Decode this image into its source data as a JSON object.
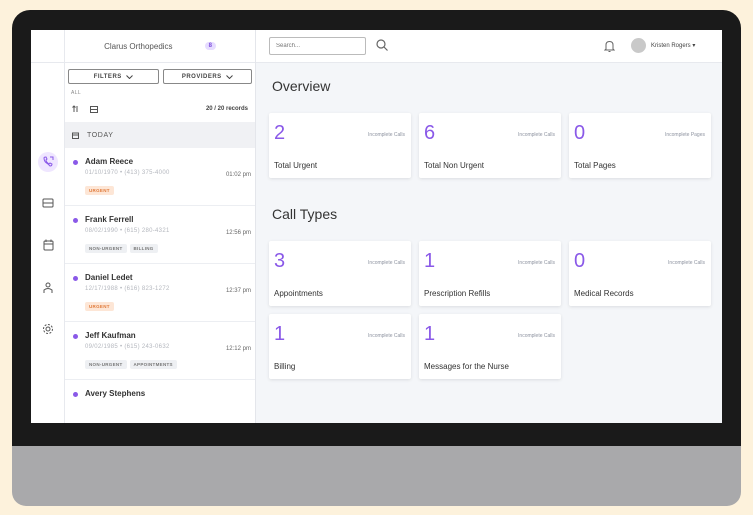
{
  "colors": {
    "accent": "#8a59e8",
    "urgent_tag": "#e07a3a",
    "background": "#fdf2dc"
  },
  "sidebar": {
    "clinic_name": "Clarus Orthopedics",
    "clinic_badge": "8"
  },
  "filters": {
    "filters_label": "FILTERS",
    "providers_label": "PROVIDERS",
    "all_label": "ALL",
    "records": "20 / 20 records"
  },
  "list": {
    "group_label": "TODAY",
    "entries": [
      {
        "name": "Adam Reece",
        "info": "01/10/1970  •  (413) 375-4000",
        "time": "01:02 pm",
        "tags": [
          "URGENT"
        ]
      },
      {
        "name": "Frank Ferrell",
        "info": "08/02/1990  •  (615) 280-4321",
        "time": "12:56 pm",
        "tags": [
          "NON-URGENT",
          "BILLING"
        ]
      },
      {
        "name": "Daniel Ledet",
        "info": "12/17/1988  •  (616) 823-1272",
        "time": "12:37 pm",
        "tags": [
          "URGENT"
        ]
      },
      {
        "name": "Jeff Kaufman",
        "info": "09/02/1985  •  (615) 243-0632",
        "time": "12:12 pm",
        "tags": [
          "NON-URGENT",
          "APPOINTMENTS"
        ]
      },
      {
        "name": "Avery Stephens",
        "info": "",
        "time": "",
        "tags": []
      }
    ]
  },
  "topbar": {
    "search_placeholder": "Search...",
    "user_name": "Kristen Rogers"
  },
  "overview": {
    "title": "Overview",
    "cards": [
      {
        "value": "2",
        "sub": "Incomplete Calls",
        "label": "Total Urgent"
      },
      {
        "value": "6",
        "sub": "Incomplete Calls",
        "label": "Total Non Urgent"
      },
      {
        "value": "0",
        "sub": "Incomplete Pages",
        "label": "Total Pages"
      }
    ]
  },
  "call_types": {
    "title": "Call Types",
    "cards": [
      {
        "value": "3",
        "sub": "Incomplete Calls",
        "label": "Appointments"
      },
      {
        "value": "1",
        "sub": "Incomplete Calls",
        "label": "Prescription Refills"
      },
      {
        "value": "0",
        "sub": "Incomplete Calls",
        "label": "Medical Records"
      },
      {
        "value": "1",
        "sub": "Incomplete Calls",
        "label": "Billing"
      },
      {
        "value": "1",
        "sub": "Incomplete Calls",
        "label": "Messages for the Nurse"
      }
    ]
  }
}
